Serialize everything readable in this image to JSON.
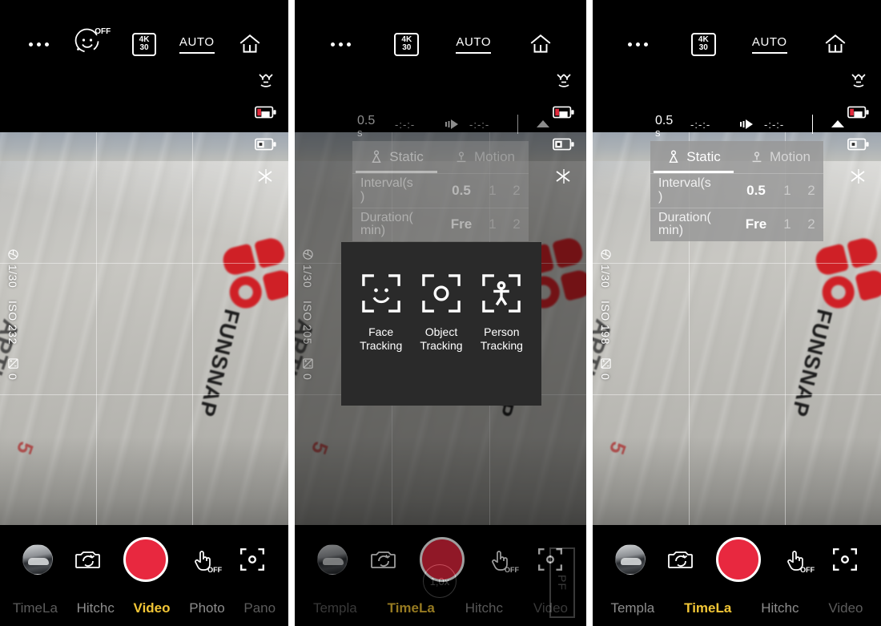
{
  "app": {
    "name": "FUNSNAP Capture 5 camera app",
    "accent_yellow": "#f2c636",
    "record_red": "#e8283f",
    "logo_red": "#cf2026"
  },
  "viewfinder": {
    "brand_text": "FUNSNAP",
    "product_text": "APTURE",
    "product_number": "5",
    "zoom_label": "1,0x",
    "pf_label": "PF"
  },
  "topbar": {
    "more_icon": "more-dots-icon",
    "smiley_label": "OFF",
    "resolution_top": "4K",
    "resolution_bottom": "30",
    "exposure_mode": "AUTO",
    "home_icon": "home-icon"
  },
  "right_rail": {
    "items": [
      {
        "icon": "home-icon",
        "label": "Home"
      },
      {
        "icon": "beauty-face-icon",
        "label": "Beauty"
      },
      {
        "icon": "battery-low-icon",
        "label": "Battery"
      },
      {
        "icon": "sd-card-icon",
        "label": "Storage"
      },
      {
        "icon": "sparkle-effect-icon",
        "label": "Effects"
      }
    ]
  },
  "exposure": {
    "shutter_icon": "shutter-icon",
    "shutter": "1/30",
    "iso_panel_1": "ISO 232",
    "iso_panel_2": "ISO 205",
    "iso_panel_3": "ISO 198",
    "ev_icon": "exposure-compensation-icon",
    "ev": "0"
  },
  "bottombar": {
    "thumbnail": "gallery-thumbnail",
    "switch_camera_icon": "switch-camera-icon",
    "record_button": "record-button",
    "gesture_icon": "hand-gesture-icon",
    "gesture_label": "OFF",
    "tracking_icon": "tracking-frame-icon",
    "modes_panel_1": [
      {
        "label": "TimeLa",
        "state": "faded"
      },
      {
        "label": "Hitchc",
        "state": "normal"
      },
      {
        "label": "Video",
        "state": "active"
      },
      {
        "label": "Photo",
        "state": "normal"
      },
      {
        "label": "Pano",
        "state": "faded"
      }
    ],
    "modes_panel_2": [
      {
        "label": "Templa",
        "state": "faded"
      },
      {
        "label": "TimeLa",
        "state": "active"
      },
      {
        "label": "Hitchc",
        "state": "normal"
      },
      {
        "label": "Video",
        "state": "faded"
      }
    ],
    "modes_panel_3": [
      {
        "label": "Templa",
        "state": "normal"
      },
      {
        "label": "TimeLa",
        "state": "active"
      },
      {
        "label": "Hitchc",
        "state": "normal"
      },
      {
        "label": "Video",
        "state": "faded"
      }
    ]
  },
  "timelapse": {
    "status": {
      "interval_value": "0.5",
      "interval_unit": "s",
      "elapsed_time": "-:-:-",
      "remaining_time": "-:-:-",
      "play_icon": "fast-forward-icon",
      "collapse_icon": "triangle-up-icon"
    },
    "tabs": [
      {
        "label": "Static",
        "icon": "static-tripod-icon",
        "active": true
      },
      {
        "label": "Motion",
        "icon": "motion-track-icon",
        "active": false
      }
    ],
    "rows": [
      {
        "label_line1": "Interval(s",
        "label_line2": ")",
        "value": "0.5",
        "options": [
          "1",
          "2"
        ]
      },
      {
        "label_line1": "Duration(",
        "label_line2": "min)",
        "value": "Fre",
        "options": [
          "1",
          "2"
        ]
      }
    ]
  },
  "tracking_popup": {
    "items": [
      {
        "icon": "face-tracking-icon",
        "line1": "Face",
        "line2": "Tracking"
      },
      {
        "icon": "object-tracking-icon",
        "line1": "Object",
        "line2": "Tracking"
      },
      {
        "icon": "person-tracking-icon",
        "line1": "Person",
        "line2": "Tracking"
      }
    ]
  }
}
